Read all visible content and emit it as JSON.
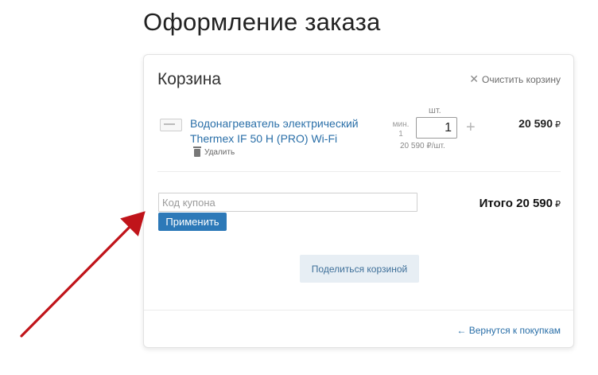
{
  "page": {
    "title": "Оформление заказа"
  },
  "cart": {
    "title": "Корзина",
    "clear_label": "Очистить корзину",
    "item": {
      "name_line1": "Водонагреватель электрический",
      "name_line2": "Thermex IF 50 H (PRO) Wi-Fi",
      "delete_label": "Удалить",
      "unit_label": "шт.",
      "min_label": "мин.",
      "min_value": "1",
      "quantity": "1",
      "plus": "+",
      "unit_price": "20 590 ₽/шт.",
      "price": "20 590",
      "currency": "₽"
    },
    "coupon": {
      "placeholder": "Код купона",
      "value": "",
      "apply_label": "Применить"
    },
    "total_label": "Итого",
    "total_value": "20 590",
    "currency": "₽",
    "share_label": "Поделиться корзиной",
    "back_label": "← Вернутся к покупкам"
  },
  "annotation": {
    "color": "#c0141a"
  },
  "icons": {
    "clear": "close-icon",
    "delete": "trash-icon",
    "thumb": "product-image"
  }
}
